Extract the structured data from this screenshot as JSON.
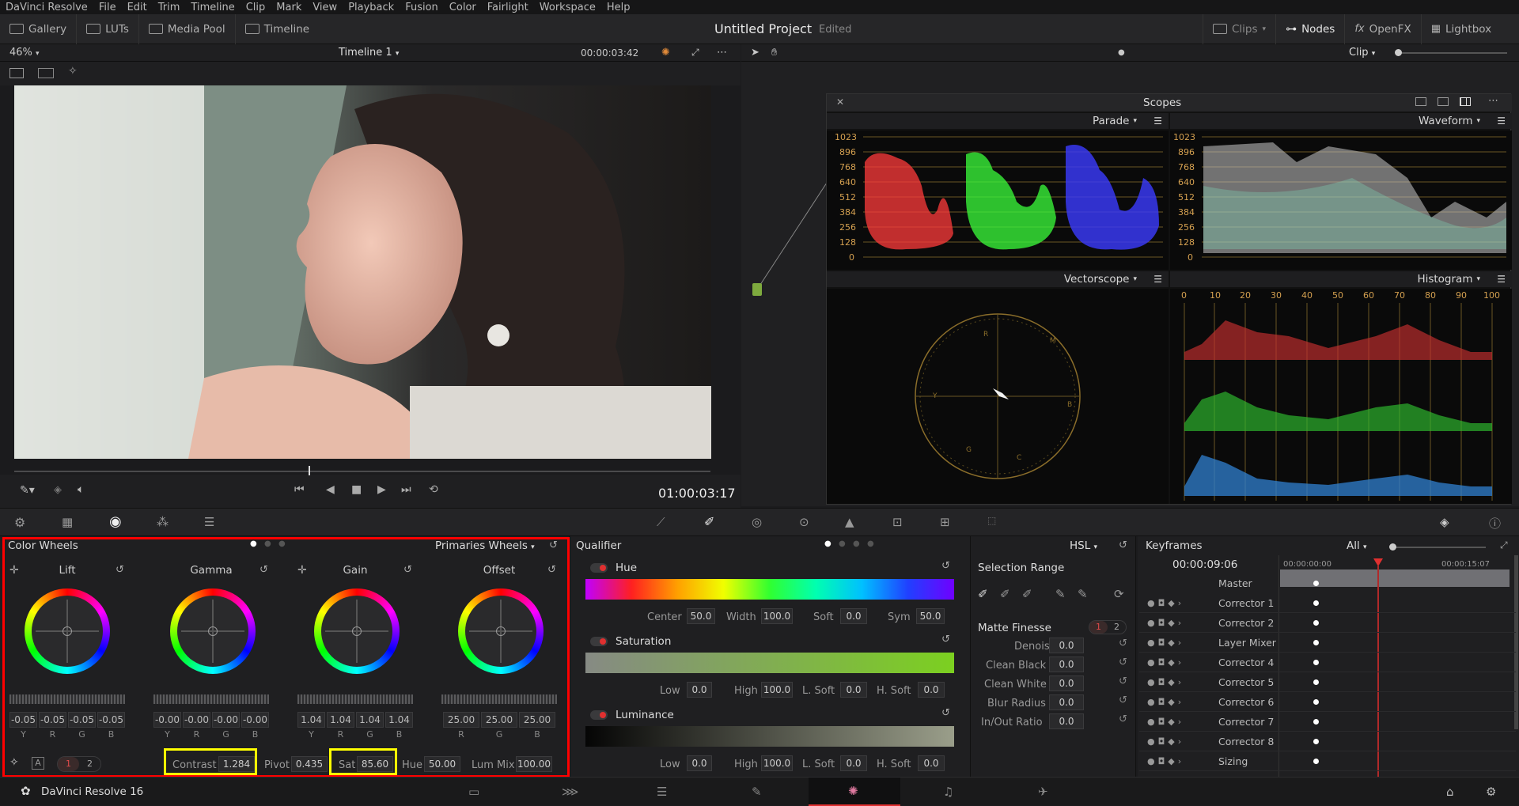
{
  "menu": [
    "DaVinci Resolve",
    "File",
    "Edit",
    "Trim",
    "Timeline",
    "Clip",
    "Mark",
    "View",
    "Playback",
    "Fusion",
    "Color",
    "Fairlight",
    "Workspace",
    "Help"
  ],
  "toolbar": {
    "left": [
      "Gallery",
      "LUTs",
      "Media Pool",
      "Timeline"
    ],
    "project_title": "Untitled Project",
    "project_status": "Edited",
    "right": [
      "Clips",
      "Nodes",
      "OpenFX",
      "Lightbox"
    ]
  },
  "viewer": {
    "zoom": "46%",
    "timeline": "Timeline 1",
    "timecode_top": "00:00:03:42",
    "timecode": "01:00:03:17"
  },
  "nodes_bar": {
    "mode": "Clip"
  },
  "scopes": {
    "title": "Scopes",
    "parade": "Parade",
    "waveform": "Waveform",
    "vectorscope": "Vectorscope",
    "histogram": "Histogram",
    "levels": [
      "1023",
      "896",
      "768",
      "640",
      "512",
      "384",
      "256",
      "128",
      "0"
    ],
    "hist_ticks": [
      "0",
      "10",
      "20",
      "30",
      "40",
      "50",
      "60",
      "70",
      "80",
      "90",
      "100"
    ],
    "vector_targets": [
      "R",
      "M",
      "B",
      "C",
      "G",
      "Y"
    ]
  },
  "color_wheels": {
    "title": "Color Wheels",
    "mode": "Primaries Wheels",
    "wheels": [
      {
        "label": "Lift",
        "values": [
          "-0.05",
          "-0.05",
          "-0.05",
          "-0.05"
        ],
        "channels": [
          "Y",
          "R",
          "G",
          "B"
        ]
      },
      {
        "label": "Gamma",
        "values": [
          "-0.00",
          "-0.00",
          "-0.00",
          "-0.00"
        ],
        "channels": [
          "Y",
          "R",
          "G",
          "B"
        ]
      },
      {
        "label": "Gain",
        "values": [
          "1.04",
          "1.04",
          "1.04",
          "1.04"
        ],
        "channels": [
          "Y",
          "R",
          "G",
          "B"
        ]
      },
      {
        "label": "Offset",
        "values": [
          "25.00",
          "25.00",
          "25.00"
        ],
        "channels": [
          "R",
          "G",
          "B"
        ]
      }
    ],
    "page1": "1",
    "page2": "2",
    "auto": "A",
    "contrast_label": "Contrast",
    "contrast": "1.284",
    "pivot_label": "Pivot",
    "pivot": "0.435",
    "sat_label": "Sat",
    "sat": "85.60",
    "hue_label": "Hue",
    "hue": "50.00",
    "lummix_label": "Lum Mix",
    "lummix": "100.00"
  },
  "qualifier": {
    "title": "Qualifier",
    "mode": "HSL",
    "hue": {
      "label": "Hue",
      "center_label": "Center",
      "center": "50.0",
      "width_label": "Width",
      "width": "100.0",
      "soft_label": "Soft",
      "soft": "0.0",
      "sym_label": "Sym",
      "sym": "50.0"
    },
    "saturation": {
      "label": "Saturation",
      "low_label": "Low",
      "low": "0.0",
      "high_label": "High",
      "high": "100.0",
      "lsoft_label": "L. Soft",
      "lsoft": "0.0",
      "hsoft_label": "H. Soft",
      "hsoft": "0.0"
    },
    "luminance": {
      "label": "Luminance",
      "low_label": "Low",
      "low": "0.0",
      "high_label": "High",
      "high": "100.0",
      "lsoft_label": "L. Soft",
      "lsoft": "0.0",
      "hsoft_label": "H. Soft",
      "hsoft": "0.0"
    },
    "selection_range": "Selection Range",
    "matte_finesse": "Matte Finesse",
    "mf_page1": "1",
    "mf_page2": "2",
    "matte": [
      {
        "label": "Denoise",
        "value": "0.0"
      },
      {
        "label": "Clean Black",
        "value": "0.0"
      },
      {
        "label": "Clean White",
        "value": "0.0"
      },
      {
        "label": "Blur Radius",
        "value": "0.0"
      },
      {
        "label": "In/Out Ratio",
        "value": "0.0"
      }
    ]
  },
  "keyframes": {
    "title": "Keyframes",
    "filter": "All",
    "timecode": "00:00:09:06",
    "ruler_start": "00:00:00:00",
    "ruler_end": "00:00:15:07",
    "master": "Master",
    "tracks": [
      "Corrector 1",
      "Corrector 2",
      "Layer Mixer",
      "Corrector 4",
      "Corrector 5",
      "Corrector 6",
      "Corrector 7",
      "Corrector 8",
      "Sizing"
    ]
  },
  "status": {
    "app": "DaVinci Resolve 16"
  }
}
